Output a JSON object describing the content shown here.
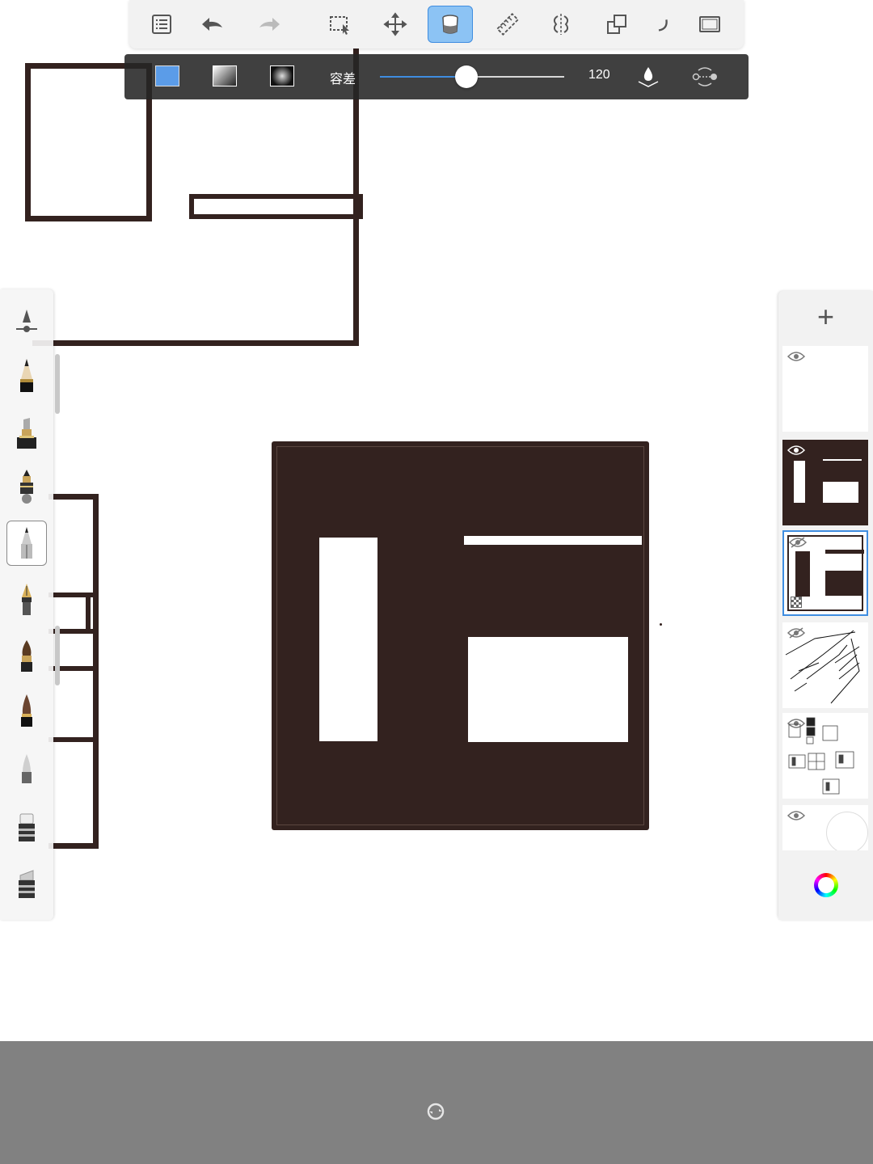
{
  "app": {
    "toolbar": {
      "buttons": [
        {
          "name": "layer-list",
          "icon": "list-icon"
        },
        {
          "name": "undo",
          "icon": "undo-arrow-icon"
        },
        {
          "name": "redo",
          "icon": "redo-arrow-icon"
        },
        {
          "name": "selection",
          "icon": "marquee-select-icon"
        },
        {
          "name": "transform",
          "icon": "move-arrows-icon"
        },
        {
          "name": "fill",
          "icon": "paint-bucket-icon",
          "active": true
        },
        {
          "name": "ruler",
          "icon": "ruler-icon"
        },
        {
          "name": "symmetry",
          "icon": "symmetry-icon"
        },
        {
          "name": "shapes",
          "icon": "shapes-icon"
        },
        {
          "name": "fullscreen",
          "icon": "frame-icon"
        }
      ]
    },
    "fill_options": {
      "solid_color": "#5b9ce8",
      "tolerance_label": "容差",
      "tolerance_value": "120",
      "tolerance_fraction": 0.47,
      "icons": [
        "linear-gradient-icon",
        "radial-gradient-icon",
        "fill-sample-icon",
        "fill-source-icon"
      ]
    },
    "brushes": [
      {
        "name": "brush-settings",
        "icon": "brush-settings-icon"
      },
      {
        "name": "pencil",
        "icon": "pencil-icon"
      },
      {
        "name": "marker",
        "icon": "marker-icon"
      },
      {
        "name": "airbrush",
        "icon": "airbrush-icon"
      },
      {
        "name": "ballpoint",
        "icon": "ballpoint-pen-icon",
        "selected": true
      },
      {
        "name": "fountain-pen",
        "icon": "fountain-pen-icon"
      },
      {
        "name": "paintbrush",
        "icon": "paintbrush-icon"
      },
      {
        "name": "ink-brush",
        "icon": "ink-brush-icon"
      },
      {
        "name": "blender",
        "icon": "blender-icon"
      },
      {
        "name": "eraser",
        "icon": "eraser-icon"
      },
      {
        "name": "hard-eraser",
        "icon": "hard-eraser-icon"
      }
    ],
    "layers": {
      "add_label": "+",
      "items": [
        {
          "name": "layer-empty",
          "visible": true
        },
        {
          "name": "layer-filled",
          "visible": true
        },
        {
          "name": "layer-outline",
          "visible": false,
          "selected": true
        },
        {
          "name": "layer-sketch",
          "visible": false
        },
        {
          "name": "layer-reference",
          "visible": true
        },
        {
          "name": "layer-background",
          "visible": true
        }
      ],
      "color_wheel_icon": "color-wheel-icon"
    },
    "bottom_bar": {
      "icon": "rotate-sync-icon"
    },
    "colors": {
      "ink": "#33221f",
      "accent": "#3f8de0",
      "toolbar_bg": "#f2f2f2",
      "fill_bar_bg": "#262626",
      "bottom_bar_bg": "#818181"
    }
  }
}
